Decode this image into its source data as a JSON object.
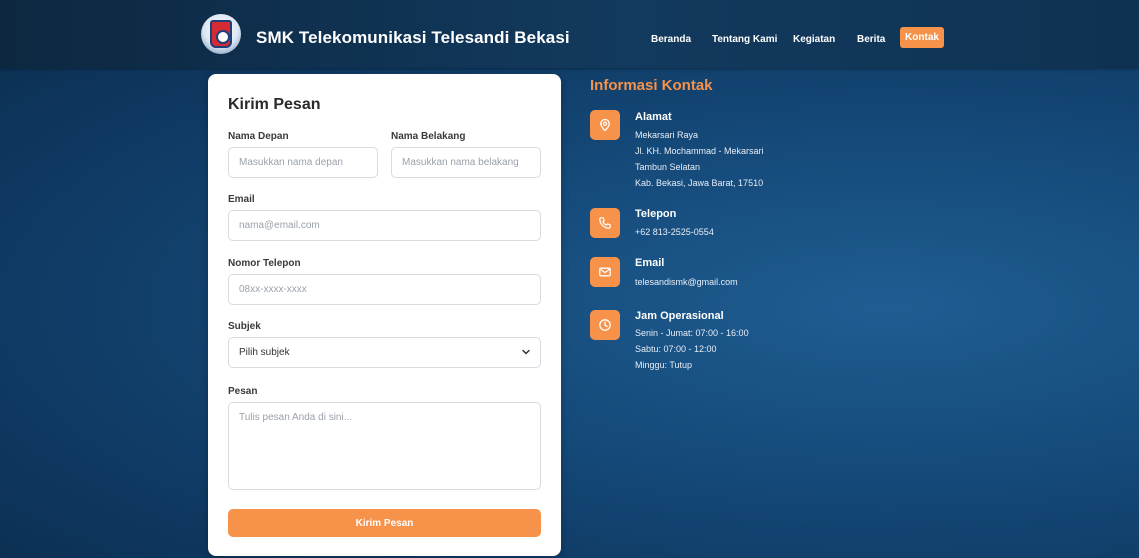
{
  "header": {
    "brand_name": "SMK Telekomunikasi Telesandi Bekasi",
    "nav": [
      "Beranda",
      "Tentang Kami",
      "Kegiatan",
      "Berita"
    ],
    "nav_active": "Kontak"
  },
  "form": {
    "title": "Kirim Pesan",
    "first_name_label": "Nama Depan",
    "first_name_placeholder": "Masukkan nama depan",
    "last_name_label": "Nama Belakang",
    "last_name_placeholder": "Masukkan nama belakang",
    "email_label": "Email",
    "email_placeholder": "nama@email.com",
    "phone_label": "Nomor Telepon",
    "phone_placeholder": "08xx-xxxx-xxxx",
    "subject_label": "Subjek",
    "subject_selected": "Pilih subjek",
    "message_label": "Pesan",
    "message_placeholder": "Tulis pesan Anda di sini...",
    "submit_label": "Kirim Pesan"
  },
  "info": {
    "title": "Informasi Kontak",
    "address_title": "Alamat",
    "address_lines": [
      "Mekarsari Raya",
      "Jl. KH. Mochammad - Mekarsari",
      "Tambun Selatan",
      "Kab. Bekasi, Jawa Barat, 17510"
    ],
    "phone_title": "Telepon",
    "phone_value": "+62 813-2525-0554",
    "email_title": "Email",
    "email_value": "telesandismk@gmail.com",
    "hours_title": "Jam Operasional",
    "hours_lines": [
      "Senin - Jumat: 07:00 - 16:00",
      "Sabtu: 07:00 - 12:00",
      "Minggu: Tutup"
    ]
  },
  "colors": {
    "accent": "#f7924a",
    "background": "#154a7a",
    "navbar": "#0f3252",
    "card": "#ffffff"
  },
  "icons": {
    "address": "location-pin-icon",
    "phone": "phone-icon",
    "email": "mail-icon",
    "hours": "clock-icon"
  }
}
